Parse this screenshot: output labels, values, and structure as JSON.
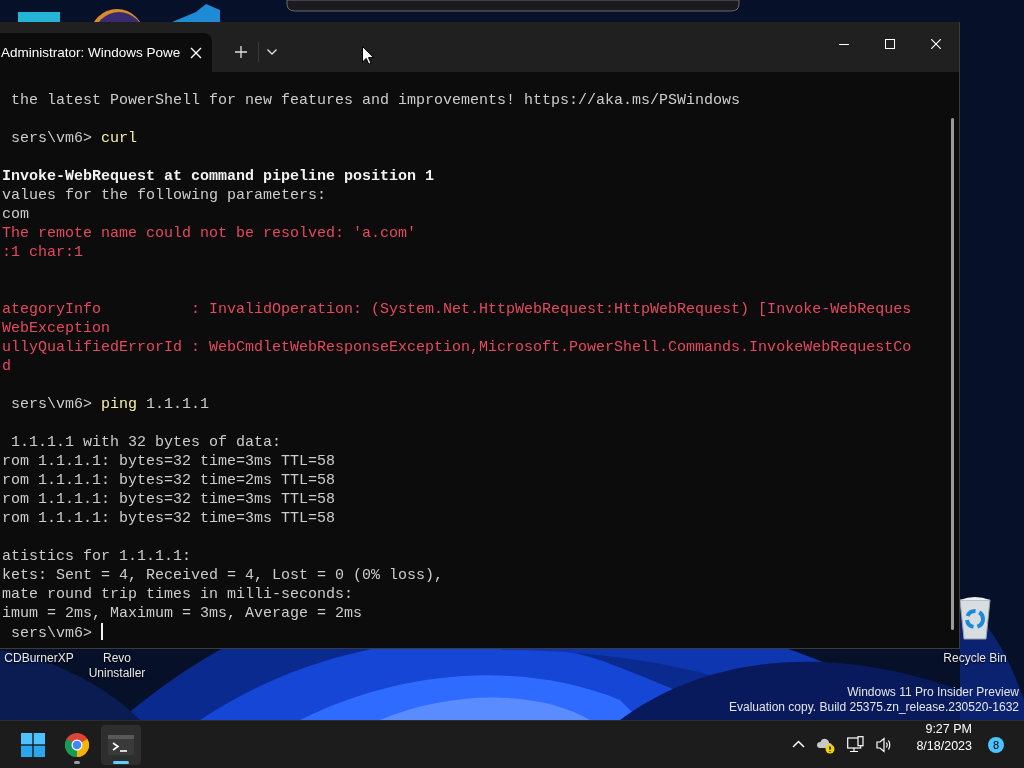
{
  "desktop": {
    "icons": [
      {
        "kind": "app",
        "label": "CDBurnerXP"
      },
      {
        "kind": "app",
        "label": "Revo Uninstaller"
      },
      {
        "kind": "recycle_bin",
        "label": "Recycle Bin"
      }
    ],
    "edition_notice": [
      "Windows 11 Pro Insider Preview",
      "Evaluation copy. Build 25375.zn_release.230520-1632"
    ]
  },
  "terminal": {
    "tabs": [
      {
        "title": "Administrator: Windows Powe",
        "selected": true
      }
    ],
    "cursor_visible": true,
    "lines": [
      {
        "segments": [
          {
            "kind": "output",
            "text": " the latest PowerShell for new features and improvements! https://aka.ms/PSWindows"
          }
        ]
      },
      {
        "segments": [
          {
            "kind": "blank"
          }
        ]
      },
      {
        "segments": [
          {
            "kind": "prompt",
            "text": " sers\\vm6> "
          },
          {
            "kind": "command",
            "text": "curl"
          }
        ]
      },
      {
        "segments": [
          {
            "kind": "blank"
          }
        ]
      },
      {
        "segments": [
          {
            "kind": "heading",
            "text": "Invoke-WebRequest at command pipeline position 1"
          }
        ]
      },
      {
        "segments": [
          {
            "kind": "output",
            "text": "values for the following parameters:"
          }
        ]
      },
      {
        "segments": [
          {
            "kind": "output",
            "text": "com"
          }
        ]
      },
      {
        "segments": [
          {
            "kind": "error",
            "text": "The remote name could not be resolved: 'a.com'"
          }
        ]
      },
      {
        "segments": [
          {
            "kind": "error",
            "text": ":1 char:1"
          }
        ]
      },
      {
        "segments": [
          {
            "kind": "blank"
          }
        ]
      },
      {
        "segments": [
          {
            "kind": "blank"
          }
        ]
      },
      {
        "segments": [
          {
            "kind": "error",
            "text": "ategoryInfo          : InvalidOperation: (System.Net.HttpWebRequest:HttpWebRequest) [Invoke-WebReques"
          }
        ]
      },
      {
        "segments": [
          {
            "kind": "error",
            "text": "WebException"
          }
        ]
      },
      {
        "segments": [
          {
            "kind": "error",
            "text": "ullyQualifiedErrorId : WebCmdletWebResponseException,Microsoft.PowerShell.Commands.InvokeWebRequestCo"
          }
        ]
      },
      {
        "segments": [
          {
            "kind": "error",
            "text": "d"
          }
        ]
      },
      {
        "segments": [
          {
            "kind": "blank"
          }
        ]
      },
      {
        "segments": [
          {
            "kind": "prompt",
            "text": " sers\\vm6> "
          },
          {
            "kind": "command",
            "text": "ping"
          },
          {
            "kind": "output",
            "text": " 1.1.1.1"
          }
        ]
      },
      {
        "segments": [
          {
            "kind": "blank"
          }
        ]
      },
      {
        "segments": [
          {
            "kind": "output",
            "text": " 1.1.1.1 with 32 bytes of data:"
          }
        ]
      },
      {
        "segments": [
          {
            "kind": "output",
            "text": "rom 1.1.1.1: bytes=32 time=3ms TTL=58"
          }
        ]
      },
      {
        "segments": [
          {
            "kind": "output",
            "text": "rom 1.1.1.1: bytes=32 time=2ms TTL=58"
          }
        ]
      },
      {
        "segments": [
          {
            "kind": "output",
            "text": "rom 1.1.1.1: bytes=32 time=3ms TTL=58"
          }
        ]
      },
      {
        "segments": [
          {
            "kind": "output",
            "text": "rom 1.1.1.1: bytes=32 time=3ms TTL=58"
          }
        ]
      },
      {
        "segments": [
          {
            "kind": "blank"
          }
        ]
      },
      {
        "segments": [
          {
            "kind": "output",
            "text": "atistics for 1.1.1.1:"
          }
        ]
      },
      {
        "segments": [
          {
            "kind": "output",
            "text": "kets: Sent = 4, Received = 4, Lost = 0 (0% loss),"
          }
        ]
      },
      {
        "segments": [
          {
            "kind": "output",
            "text": "mate round trip times in milli-seconds:"
          }
        ]
      },
      {
        "segments": [
          {
            "kind": "output",
            "text": "imum = 2ms, Maximum = 3ms, Average = 2ms"
          }
        ]
      },
      {
        "segments": [
          {
            "kind": "prompt",
            "text": " sers\\vm6> "
          },
          {
            "kind": "cursor"
          }
        ]
      }
    ]
  },
  "taskbar": {
    "apps": [
      {
        "kind": "start",
        "selected": false,
        "running": false
      },
      {
        "kind": "browser",
        "selected": false,
        "running": true
      },
      {
        "kind": "terminal",
        "selected": true,
        "running": true
      }
    ],
    "tray": {
      "onedrive_warning": true,
      "time": "9:27 PM",
      "date": "8/18/2023",
      "notifications": "8"
    }
  }
}
